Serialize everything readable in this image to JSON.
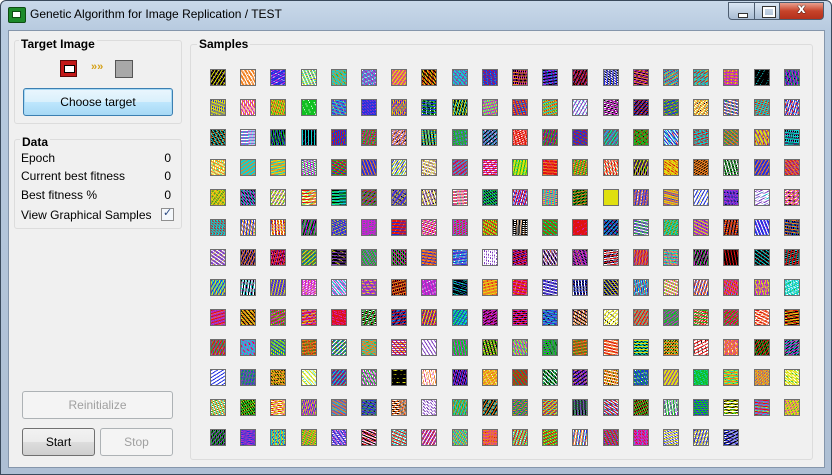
{
  "window": {
    "title": "Genetic Algorithm for Image Replication / TEST",
    "close_glyph": "x"
  },
  "target_group": {
    "title": "Target Image",
    "arrow_glyph": "»»",
    "choose_button": "Choose target"
  },
  "data_group": {
    "title": "Data",
    "rows": [
      {
        "label": "Epoch",
        "value": "0"
      },
      {
        "label": "Current best fitness",
        "value": "0"
      },
      {
        "label": "Best fitness %",
        "value": "0"
      }
    ],
    "view_samples": {
      "label": "View Graphical Samples",
      "checked": true
    }
  },
  "buttons": {
    "reinitialize": "Reinitialize",
    "start": "Start",
    "stop": "Stop"
  },
  "samples": {
    "title": "Samples",
    "columns": 20,
    "count": 258
  },
  "colors": {
    "accent_target": "#c31818",
    "arrow": "#d4a017"
  }
}
